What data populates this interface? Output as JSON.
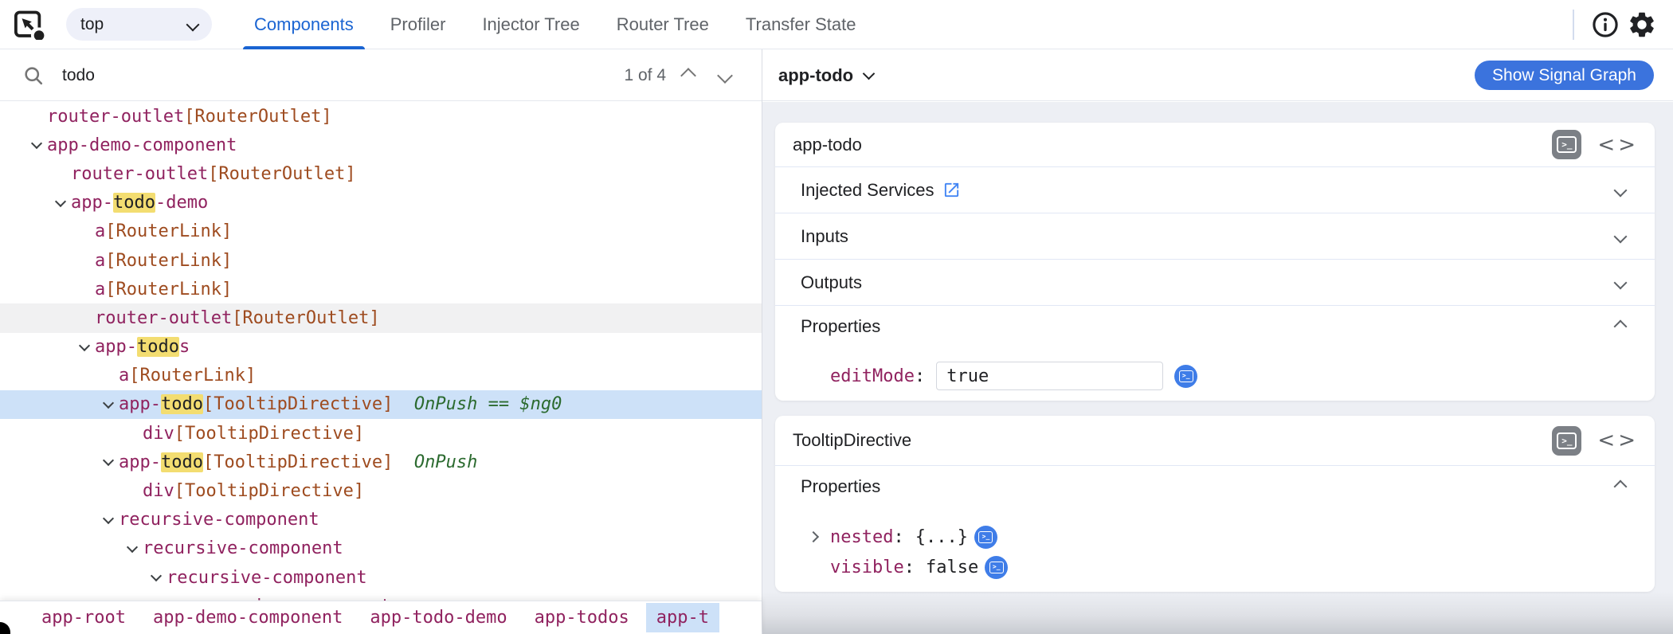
{
  "topbar": {
    "frame_selector": {
      "value": "top"
    },
    "tabs": [
      {
        "label": "Components",
        "active": true
      },
      {
        "label": "Profiler",
        "active": false
      },
      {
        "label": "Injector Tree",
        "active": false
      },
      {
        "label": "Router Tree",
        "active": false
      },
      {
        "label": "Transfer State",
        "active": false
      }
    ],
    "icons": [
      "element-picker-icon",
      "info-icon",
      "settings-icon"
    ]
  },
  "search": {
    "value": "todo",
    "placeholder": "",
    "match_count": "1 of 4"
  },
  "tree": {
    "rows": [
      {
        "level": 1,
        "expandable": false,
        "state": "",
        "segments": [
          {
            "type": "name",
            "text": "router-outlet"
          },
          {
            "type": "dir",
            "text": "[RouterOutlet]"
          }
        ]
      },
      {
        "level": 1,
        "expandable": true,
        "state": "",
        "segments": [
          {
            "type": "name",
            "text": "app-demo-component"
          }
        ]
      },
      {
        "level": 2,
        "expandable": false,
        "state": "",
        "segments": [
          {
            "type": "name",
            "text": "router-outlet"
          },
          {
            "type": "dir",
            "text": "[RouterOutlet]"
          }
        ]
      },
      {
        "level": 2,
        "expandable": true,
        "state": "",
        "segments": [
          {
            "type": "name",
            "text": "app-"
          },
          {
            "type": "hl",
            "text": "todo"
          },
          {
            "type": "name",
            "text": "-demo"
          }
        ]
      },
      {
        "level": 3,
        "expandable": false,
        "state": "",
        "segments": [
          {
            "type": "name",
            "text": "a"
          },
          {
            "type": "dir",
            "text": "[RouterLink]"
          }
        ]
      },
      {
        "level": 3,
        "expandable": false,
        "state": "",
        "segments": [
          {
            "type": "name",
            "text": "a"
          },
          {
            "type": "dir",
            "text": "[RouterLink]"
          }
        ]
      },
      {
        "level": 3,
        "expandable": false,
        "state": "",
        "segments": [
          {
            "type": "name",
            "text": "a"
          },
          {
            "type": "dir",
            "text": "[RouterLink]"
          }
        ]
      },
      {
        "level": 3,
        "expandable": false,
        "state": "hover",
        "segments": [
          {
            "type": "name",
            "text": "router-outlet"
          },
          {
            "type": "dir",
            "text": "[RouterOutlet]"
          }
        ]
      },
      {
        "level": 3,
        "expandable": true,
        "state": "",
        "segments": [
          {
            "type": "name",
            "text": "app-"
          },
          {
            "type": "hl",
            "text": "todo"
          },
          {
            "type": "name",
            "text": "s"
          }
        ]
      },
      {
        "level": 4,
        "expandable": false,
        "state": "",
        "segments": [
          {
            "type": "name",
            "text": "a"
          },
          {
            "type": "dir",
            "text": "[RouterLink]"
          }
        ]
      },
      {
        "level": 4,
        "expandable": true,
        "state": "selected",
        "segments": [
          {
            "type": "name",
            "text": "app-"
          },
          {
            "type": "hl",
            "text": "todo"
          },
          {
            "type": "dir",
            "text": "[TooltipDirective]"
          },
          {
            "type": "meta",
            "text": "  OnPush == $ng0"
          }
        ]
      },
      {
        "level": 5,
        "expandable": false,
        "state": "",
        "segments": [
          {
            "type": "name",
            "text": "div"
          },
          {
            "type": "dir",
            "text": "[TooltipDirective]"
          }
        ]
      },
      {
        "level": 4,
        "expandable": true,
        "state": "",
        "segments": [
          {
            "type": "name",
            "text": "app-"
          },
          {
            "type": "hl",
            "text": "todo"
          },
          {
            "type": "dir",
            "text": "[TooltipDirective]"
          },
          {
            "type": "meta",
            "text": "  OnPush"
          }
        ]
      },
      {
        "level": 5,
        "expandable": false,
        "state": "",
        "segments": [
          {
            "type": "name",
            "text": "div"
          },
          {
            "type": "dir",
            "text": "[TooltipDirective]"
          }
        ]
      },
      {
        "level": 4,
        "expandable": true,
        "state": "",
        "segments": [
          {
            "type": "name",
            "text": "recursive-component"
          }
        ]
      },
      {
        "level": 5,
        "expandable": true,
        "state": "",
        "segments": [
          {
            "type": "name",
            "text": "recursive-component"
          }
        ]
      },
      {
        "level": 6,
        "expandable": true,
        "state": "",
        "segments": [
          {
            "type": "name",
            "text": "recursive-component"
          }
        ]
      },
      {
        "level": 7,
        "expandable": true,
        "state": "",
        "segments": [
          {
            "type": "name",
            "text": "recursive-component"
          }
        ]
      }
    ]
  },
  "breadcrumb": {
    "items": [
      {
        "label": "app-root",
        "selected": false
      },
      {
        "label": "app-demo-component",
        "selected": false
      },
      {
        "label": "app-todo-demo",
        "selected": false
      },
      {
        "label": "app-todos",
        "selected": false
      },
      {
        "label": "app-t",
        "selected": true
      }
    ]
  },
  "inspector": {
    "title": "app-todo",
    "signal_button": "Show Signal Graph",
    "cards": [
      {
        "title": "app-todo",
        "sections": [
          {
            "label": "Injected Services",
            "external_link": true,
            "chevron": "down",
            "props": []
          },
          {
            "label": "Inputs",
            "external_link": false,
            "chevron": "down",
            "props": []
          },
          {
            "label": "Outputs",
            "external_link": false,
            "chevron": "down",
            "props": []
          },
          {
            "label": "Properties",
            "external_link": false,
            "chevron": "up",
            "props": [
              {
                "name": "editMode",
                "value": "true",
                "kind": "input"
              }
            ]
          }
        ]
      },
      {
        "title": "TooltipDirective",
        "sections": [
          {
            "label": "Properties",
            "external_link": false,
            "chevron": "up",
            "props": [
              {
                "name": "nested",
                "value": "{...}",
                "kind": "object"
              },
              {
                "name": "visible",
                "value": "false",
                "kind": "plain"
              }
            ]
          }
        ]
      }
    ]
  },
  "colors": {
    "tab_active": "#1a64d2",
    "selection_blue": "#cde1f8",
    "search_highlight": "#f3dd71",
    "element_name": "#90225f",
    "directive": "#9e4b1f",
    "change_detection_meta": "#2c6b30",
    "signal_button_blue": "#3b73dd",
    "console_circle_blue": "#3f7de8",
    "external_link_blue": "#4285f4",
    "console_square_gray": "#7c8086"
  }
}
